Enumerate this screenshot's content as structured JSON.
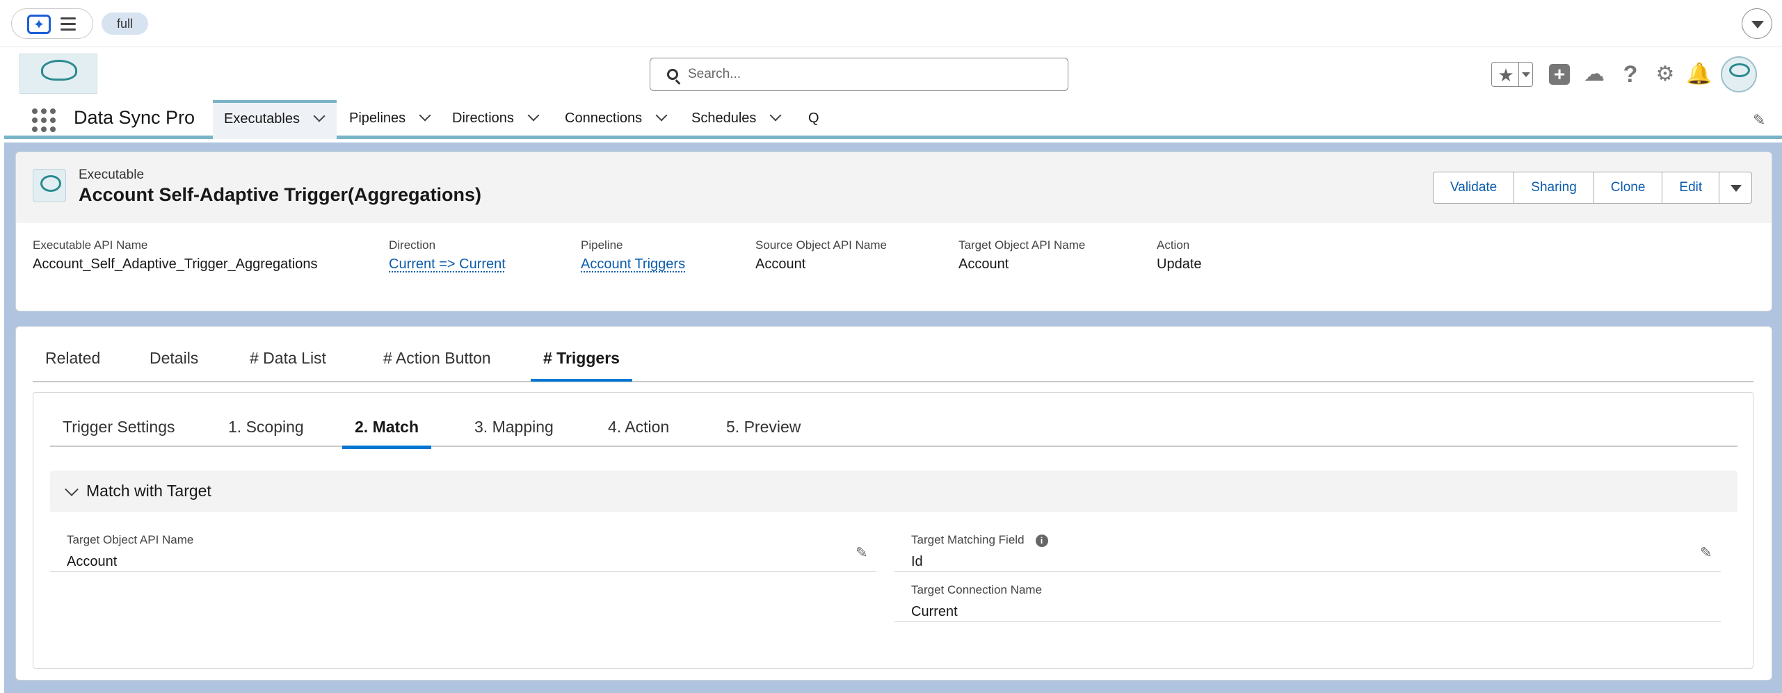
{
  "topbar": {
    "env_badge": "full"
  },
  "search": {
    "placeholder": "Search..."
  },
  "app": {
    "name": "Data Sync Pro"
  },
  "nav": {
    "items": [
      {
        "label": "Executables"
      },
      {
        "label": "Pipelines"
      },
      {
        "label": "Directions"
      },
      {
        "label": "Connections"
      },
      {
        "label": "Schedules"
      },
      {
        "label": "Q"
      }
    ]
  },
  "record": {
    "type": "Executable",
    "title": "Account Self-Adaptive Trigger(Aggregations)",
    "actions": [
      {
        "label": "Validate"
      },
      {
        "label": "Sharing"
      },
      {
        "label": "Clone"
      },
      {
        "label": "Edit"
      }
    ],
    "fields": [
      {
        "label": "Executable API Name",
        "value": "Account_Self_Adaptive_Trigger_Aggregations"
      },
      {
        "label": "Direction",
        "value": "Current => Current"
      },
      {
        "label": "Pipeline",
        "value": "Account Triggers"
      },
      {
        "label": "Source Object API Name",
        "value": "Account"
      },
      {
        "label": "Target Object API Name",
        "value": "Account"
      },
      {
        "label": "Action",
        "value": "Update"
      }
    ]
  },
  "tabs": [
    {
      "label": "Related"
    },
    {
      "label": "Details"
    },
    {
      "label": "# Data List"
    },
    {
      "label": "# Action Button"
    },
    {
      "label": "# Triggers"
    }
  ],
  "subtabs": [
    {
      "label": "Trigger Settings"
    },
    {
      "label": "1. Scoping"
    },
    {
      "label": "2. Match"
    },
    {
      "label": "3. Mapping"
    },
    {
      "label": "4. Action"
    },
    {
      "label": "5. Preview"
    }
  ],
  "section": {
    "title": "Match with Target",
    "fields": [
      {
        "label": "Target Object API Name",
        "value": "Account"
      },
      {
        "label": "Target Matching Field",
        "value": "Id"
      },
      {
        "label": "Target Connection Name",
        "value": "Current"
      }
    ]
  },
  "colors": {
    "accent": "#0176d3",
    "link": "#0b5cab",
    "brand_band": "#79b4c8",
    "page_background": "#b0c4df"
  },
  "icons": [
    "agent-icon",
    "menu-icon",
    "search-icon",
    "star-icon",
    "plus-icon",
    "cloud-icon",
    "help-icon",
    "gear-icon",
    "bell-icon",
    "app-launcher-icon",
    "pencil-icon",
    "info-icon",
    "chevron-down-icon"
  ]
}
